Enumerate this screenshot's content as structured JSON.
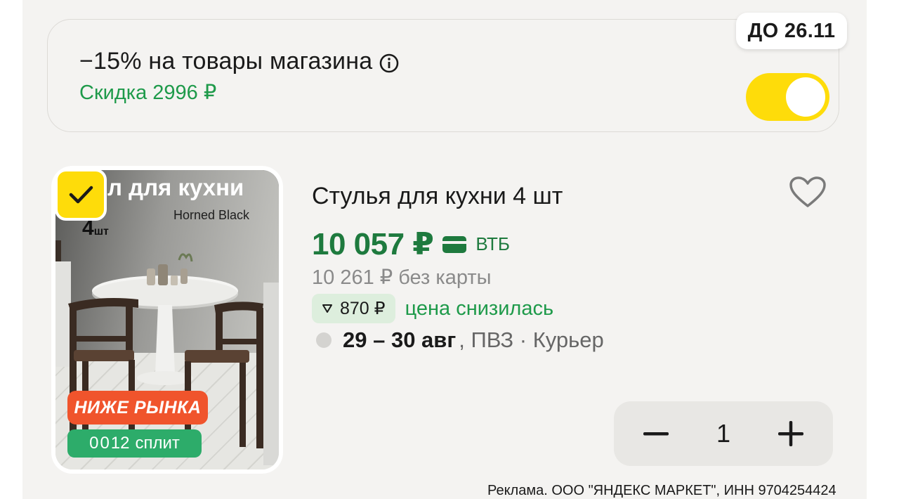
{
  "promo": {
    "title": "−15% на товары магазина",
    "discount": "Скидка 2996 ₽",
    "until": "ДО 26.11",
    "toggle_on": true,
    "accent_color": "#fedc0a"
  },
  "product": {
    "image": {
      "title": "л для кухни",
      "brand": "Horned Black",
      "qty": "4",
      "qty_unit": "шт",
      "badge_below_market": "НИЖЕ РЫНКА",
      "split_digit_a": "0",
      "split_digit_b": "0",
      "split_num": "12",
      "split_label": "сплит"
    },
    "selected": true,
    "name": "Стулья для кухни 4 шт",
    "price": "10 057 ₽",
    "bank": "ВТБ",
    "price_without_card": "10 261 ₽  без карты",
    "price_drop": "870 ₽",
    "price_drop_label": "цена снизилась",
    "delivery_date": "29 – 30 авг",
    "delivery_methods": ", ПВЗ · Курьер",
    "quantity": "1",
    "price_color": "#1e7a3e"
  },
  "ad_disclaimer": "Реклама. ООО \"ЯНДЕКС МАРКЕТ\", ИНН 9704254424",
  "icons": {
    "info": "info-icon",
    "check": "check-icon",
    "heart": "heart-icon",
    "card": "card-icon",
    "minus": "minus-icon",
    "plus": "plus-icon"
  }
}
